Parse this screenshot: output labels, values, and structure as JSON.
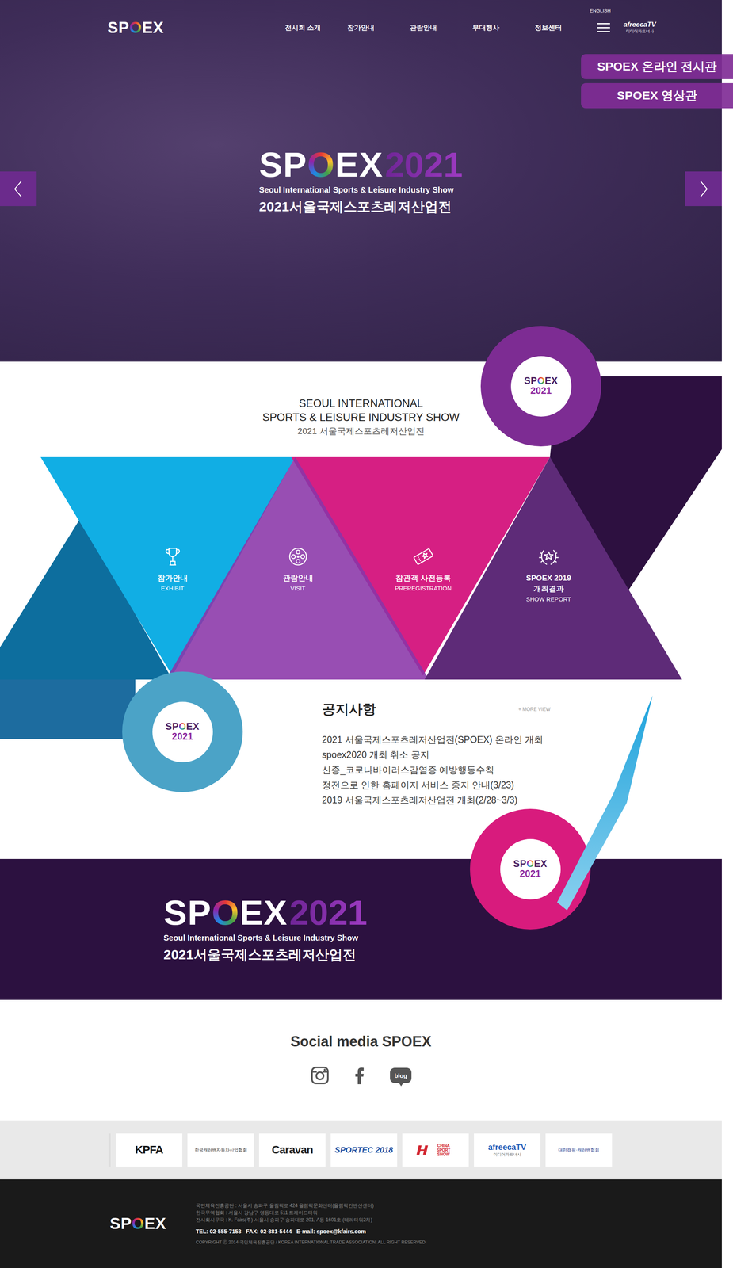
{
  "brand": {
    "logo": [
      {
        "text": "SP",
        "ring": false
      },
      {
        "text": "O",
        "ring": true
      },
      {
        "text": "EX",
        "ring": false
      }
    ]
  },
  "header": {
    "language": "ENGLISH",
    "nav": [
      "전시회 소개",
      "참가안내",
      "관람안내",
      "부대행사",
      "정보센터"
    ],
    "partner": {
      "name": "afreecaTV",
      "caption": "미디어파트너사"
    },
    "quick_links": [
      "SPOEX 온라인 전시관",
      "SPOEX 영상관"
    ]
  },
  "hero": {
    "year": "2021",
    "subtitle": "Seoul International Sports & Leisure Industry Show",
    "title": "2021서울국제스포츠레저산업전"
  },
  "intro": {
    "lines": [
      "SEOUL INTERNATIONAL",
      "SPORTS & LEISURE INDUSTRY SHOW"
    ],
    "sub": "2021 서울국제스포츠레저산업전"
  },
  "badge": {
    "year": "2021"
  },
  "features": [
    {
      "kind": "trophy",
      "title": [
        "참가안내"
      ],
      "sub": "EXHIBIT"
    },
    {
      "kind": "reel",
      "title": [
        "관람안내"
      ],
      "sub": "VISIT"
    },
    {
      "kind": "ticket",
      "title": [
        "참관객 사전등록"
      ],
      "sub": "PREREGISTRATION"
    },
    {
      "kind": "laurel",
      "title": [
        "SPOEX 2019",
        "개최결과"
      ],
      "sub": "SHOW REPORT"
    }
  ],
  "notice": {
    "title": "공지사항",
    "more": "+ MORE VIEW",
    "items": [
      "2021 서울국제스포츠레저산업전(SPOEX) 온라인 개최",
      "spoex2020 개최 취소 공지",
      "신종_코로나바이러스감염증 예방행동수칙",
      "정전으로 인한 홈페이지 서비스 중지 안내(3/23)",
      "2019 서울국제스포츠레저산업전 개최(2/28~3/3)"
    ]
  },
  "banner": {
    "year": "2021",
    "subtitle": "Seoul International Sports & Leisure Industry Show",
    "title": "2021서울국제스포츠레저산업전"
  },
  "social": {
    "title": "Social media SPOEX",
    "items": [
      {
        "kind": "instagram"
      },
      {
        "kind": "facebook"
      },
      {
        "kind": "blog",
        "text": "blog"
      }
    ]
  },
  "partners": [
    {
      "text": "KPFA",
      "kind": "bold",
      "color": "#111111"
    },
    {
      "text": "한국캐러밴자동차산업협회",
      "kind": "small",
      "color": "#333333"
    },
    {
      "text": "Caravan",
      "kind": "bold",
      "color": "#222222"
    },
    {
      "text": "SPORTEC 2018",
      "kind": "italic",
      "color": "#1d4fa0"
    },
    {
      "text": "CHINA SPORT SHOW",
      "kind": "mark",
      "color": "#d22630"
    },
    {
      "text": "afreecaTV",
      "caption": "미디어파트너사",
      "kind": "caption",
      "color": "#1e5bb8"
    },
    {
      "text": "대한캠핑·캐러밴협회",
      "kind": "small",
      "color": "#1d3c8f"
    }
  ],
  "footer": {
    "lines": [
      "국민체육진흥공단 : 서울시 송파구 올림픽로 424 올림픽문화센터(올림픽컨벤션센터)",
      "한국무역협회 : 서울시 강남구 영동대로 511 트레이드타워",
      "전시회사무국 : K. Fairs(주) 서울시 송파구 송파대로 201, A동 1601호 (테라타워2차)"
    ],
    "contact": "TEL: 02-555-7153   FAX: 02-881-5444   E-mail: spoex@kfairs.com",
    "copyright": "COPYRIGHT ⓒ 2014 국민체육진흥공단 / KOREA INTERNATIONAL TRADE ASSOCIATION. ALL RIGHT RESERVED."
  }
}
